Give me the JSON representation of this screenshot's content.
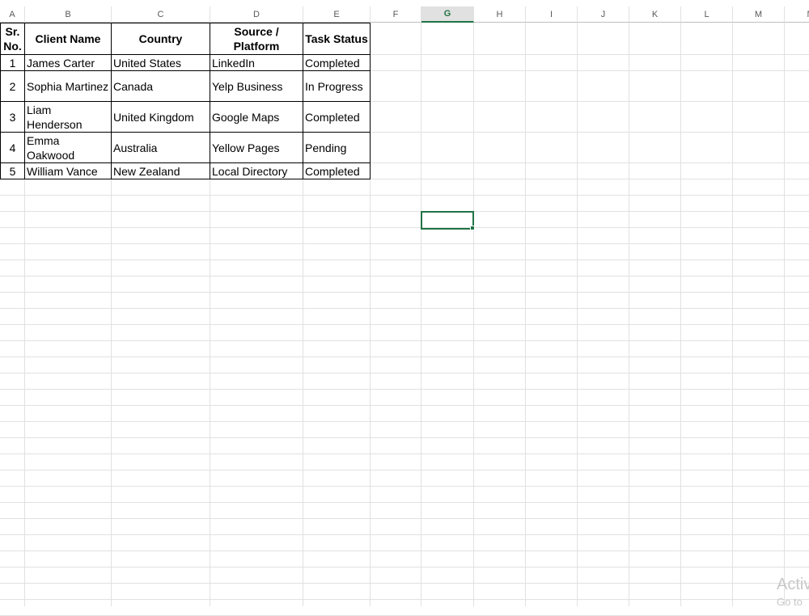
{
  "columns": [
    "A",
    "B",
    "C",
    "D",
    "E",
    "F",
    "G",
    "H",
    "I",
    "J",
    "K",
    "L",
    "M",
    "N"
  ],
  "active_column": "G",
  "table": {
    "headers": [
      "Sr. No.",
      "Client Name",
      "Country",
      "Source / Platform",
      "Task Status"
    ],
    "rows": [
      [
        "1",
        "James Carter",
        "United States",
        "LinkedIn",
        "Completed"
      ],
      [
        "2",
        "Sophia Martinez",
        "Canada",
        "Yelp Business",
        "In Progress"
      ],
      [
        "3",
        "Liam Henderson",
        "United Kingdom",
        "Google Maps",
        "Completed"
      ],
      [
        "4",
        "Emma Oakwood",
        "Australia",
        "Yellow Pages",
        "Pending"
      ],
      [
        "5",
        "William Vance",
        "New Zealand",
        "Local Directory",
        "Completed"
      ]
    ]
  },
  "watermark": {
    "line1": "Activ",
    "line2": "Go to"
  }
}
